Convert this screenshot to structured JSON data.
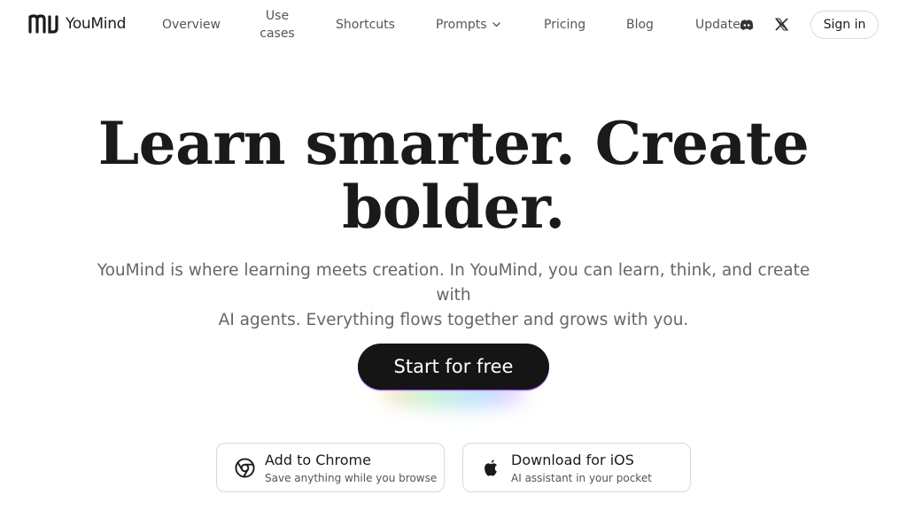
{
  "brand": {
    "name": "YouMind"
  },
  "nav": {
    "overview": "Overview",
    "use_cases_line1": "Use",
    "use_cases_line2": "cases",
    "shortcuts": "Shortcuts",
    "prompts": "Prompts",
    "pricing": "Pricing",
    "blog": "Blog",
    "updates": "Updates",
    "sign_in": "Sign in"
  },
  "icons": {
    "logo": "youmind-logo-icon",
    "prompts_dropdown": "chevron-down-icon",
    "discord": "discord-icon",
    "x": "x-logo-icon",
    "chrome": "chrome-icon",
    "apple": "apple-icon"
  },
  "hero": {
    "headline_line1": "Learn smarter. Create",
    "headline_line2": "bolder.",
    "subtitle_line1": "YouMind is where learning meets creation. In YouMind, you can learn, think, and create with",
    "subtitle_line2": "AI agents. Everything flows together and grows with you.",
    "cta_label": "Start for free"
  },
  "downloads": {
    "chrome": {
      "title": "Add to Chrome",
      "subtitle": "Save anything while you browse"
    },
    "ios": {
      "title": "Download for iOS",
      "subtitle": "AI assistant in your pocket"
    }
  },
  "colors": {
    "text": "#1a1a1a",
    "muted": "#666666",
    "cta_background": "#151515",
    "border": "#d9d9d9"
  }
}
